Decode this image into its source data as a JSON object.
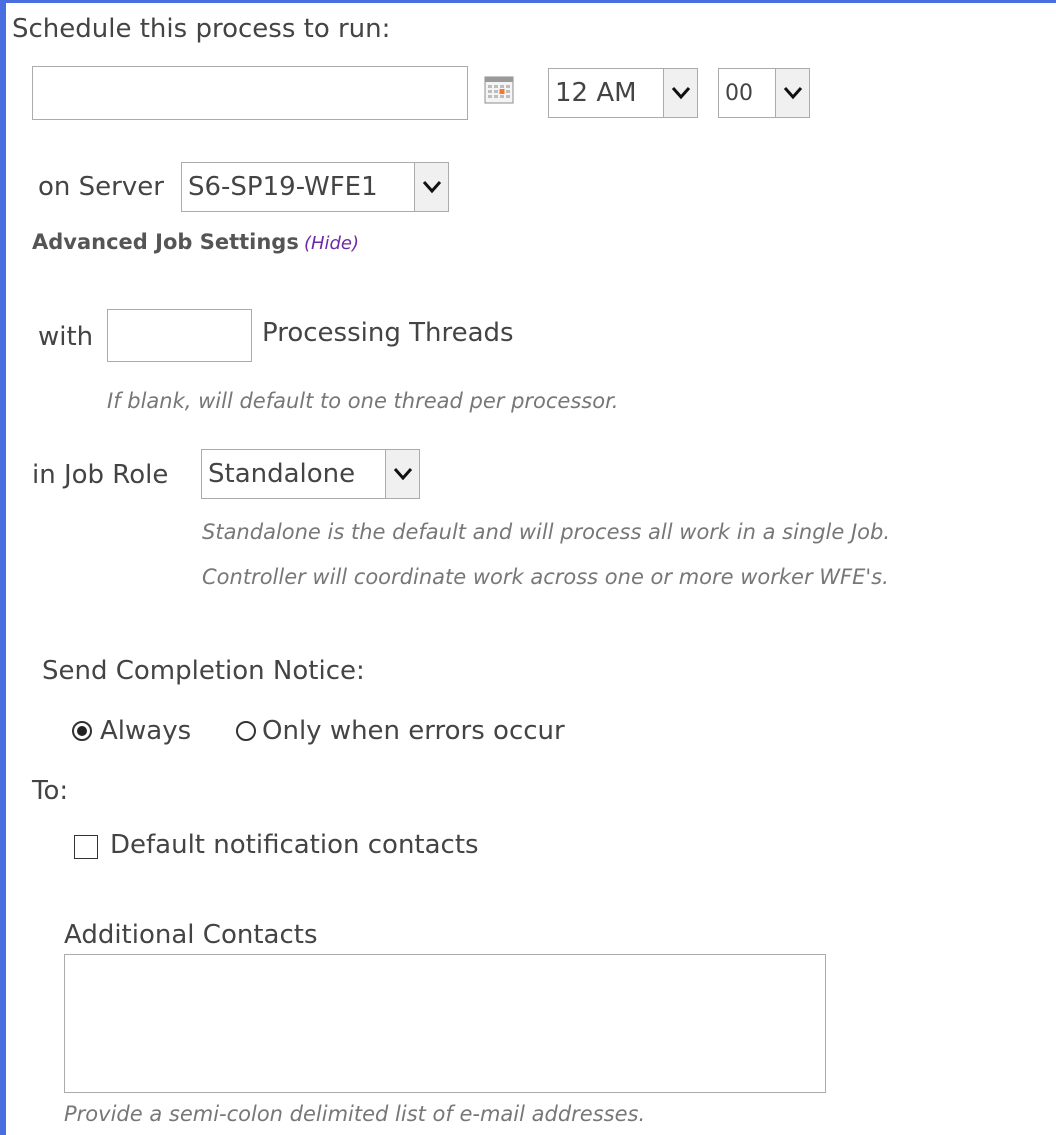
{
  "schedule": {
    "heading": "Schedule this process to run:",
    "date_value": "",
    "hour": "12 AM",
    "minute": "00"
  },
  "server": {
    "label": "on Server",
    "value": "S6-SP19-WFE1"
  },
  "advanced": {
    "title": "Advanced Job Settings",
    "toggle_label": "(Hide)"
  },
  "threads": {
    "prefix": "with",
    "value": "",
    "suffix": "Processing Threads",
    "hint": "If blank, will default to one thread per processor."
  },
  "job_role": {
    "label": "in Job Role",
    "value": "Standalone",
    "hint_line1": "Standalone is the default and will process all work in a single Job.",
    "hint_line2": "Controller will coordinate work across one or more worker WFE's."
  },
  "completion": {
    "heading": "Send Completion Notice:",
    "option_always": "Always",
    "option_errors": "Only when errors occur",
    "selected": "Always",
    "to_label": "To:",
    "default_contacts_label": "Default notification contacts",
    "default_contacts_checked": false,
    "additional_label": "Additional Contacts",
    "additional_value": "",
    "additional_hint": "Provide a semi-colon delimited list of e-mail addresses."
  },
  "colors": {
    "frame_border": "#4a6ee0",
    "hide_link": "#6e2aa5"
  }
}
